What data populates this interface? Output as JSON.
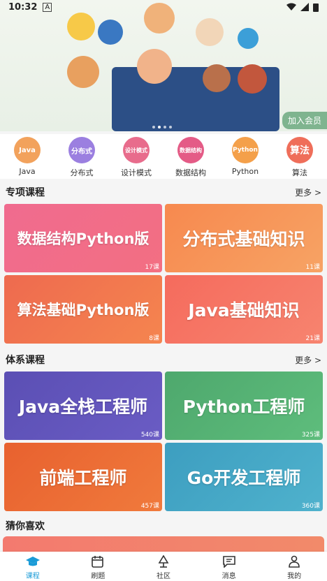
{
  "status": {
    "time": "10:32",
    "notif_icon": "A"
  },
  "banner": {
    "join_label": "加入会员"
  },
  "categories": [
    {
      "circle": "Java",
      "label": "Java",
      "color": "#f2a25c"
    },
    {
      "circle": "分布式",
      "label": "分布式",
      "color": "#9b7fe0"
    },
    {
      "circle": "设计模式",
      "label": "设计模式",
      "color": "#e86c8c"
    },
    {
      "circle": "数据结构",
      "label": "数据结构",
      "color": "#e45b86"
    },
    {
      "circle": "Python",
      "label": "Python",
      "color": "#f4a04a"
    },
    {
      "circle": "算法",
      "label": "算法",
      "color": "#ef6e5a"
    }
  ],
  "special": {
    "title": "专项课程",
    "more": "更多 >",
    "cards": [
      {
        "title": "数据结构Python版",
        "count": "17课"
      },
      {
        "title": "分布式基础知识",
        "count": "11课"
      },
      {
        "title": "算法基础Python版",
        "count": "8课"
      },
      {
        "title": "Java基础知识",
        "count": "21课"
      }
    ]
  },
  "system": {
    "title": "体系课程",
    "more": "更多 >",
    "cards": [
      {
        "title": "Java全栈工程师",
        "count": "540课"
      },
      {
        "title": "Python工程师",
        "count": "325课"
      },
      {
        "title": "前端工程师",
        "count": "457课"
      },
      {
        "title": "Go开发工程师",
        "count": "360课"
      }
    ]
  },
  "guess": {
    "title": "猜你喜欢"
  },
  "tabs": [
    {
      "label": "课程",
      "icon": "graduation-cap-icon"
    },
    {
      "label": "刷题",
      "icon": "calendar-edit-icon"
    },
    {
      "label": "社区",
      "icon": "tree-icon"
    },
    {
      "label": "消息",
      "icon": "message-icon"
    },
    {
      "label": "我的",
      "icon": "person-icon"
    }
  ]
}
